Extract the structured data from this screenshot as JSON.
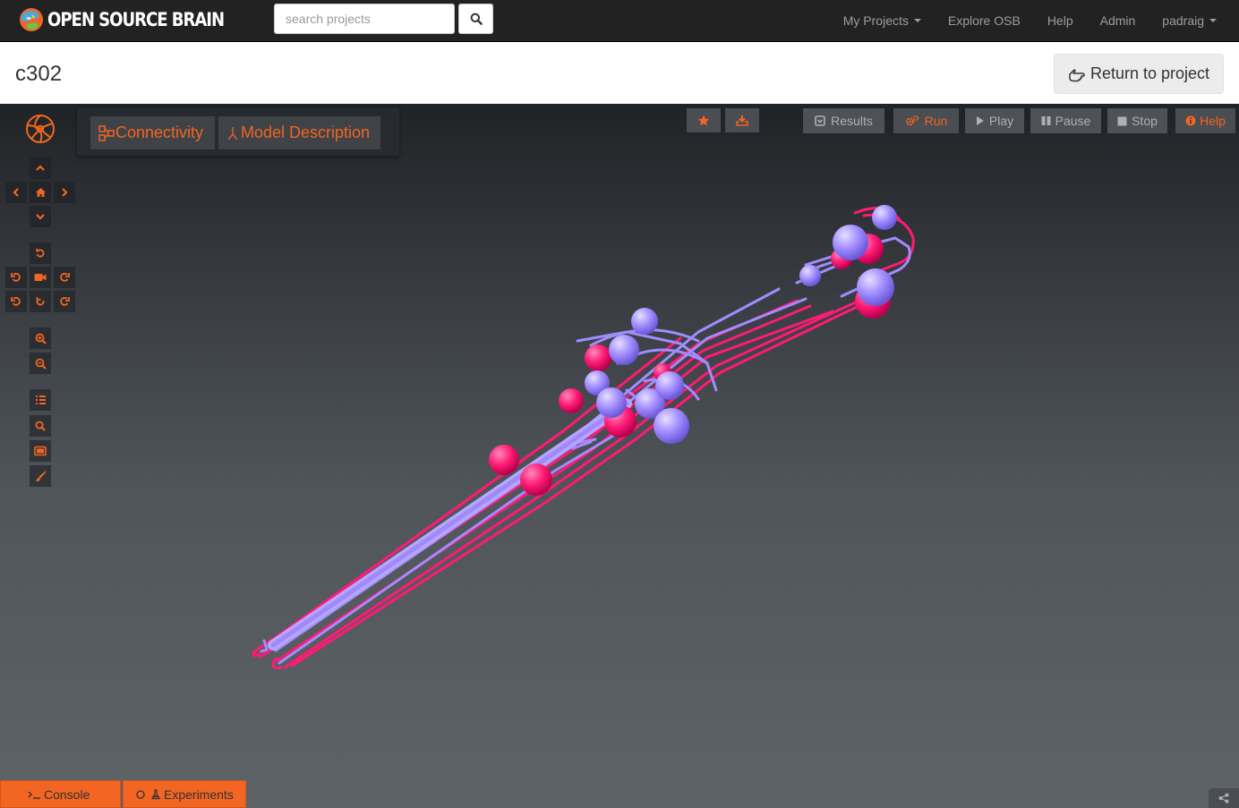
{
  "navbar": {
    "brand": "OPEN SOURCE BRAIN",
    "search_placeholder": "search projects",
    "links": [
      {
        "label": "My Projects",
        "dropdown": true
      },
      {
        "label": "Explore OSB",
        "dropdown": false
      },
      {
        "label": "Help",
        "dropdown": false
      },
      {
        "label": "Admin",
        "dropdown": false
      },
      {
        "label": "padraig",
        "dropdown": true
      }
    ]
  },
  "header": {
    "title": "c302",
    "return_label": "Return to project"
  },
  "viewer": {
    "tabs": {
      "connectivity": "Connectivity",
      "model_description": "Model Description"
    },
    "toolbar": {
      "results": "Results",
      "run": "Run",
      "play": "Play",
      "pause": "Pause",
      "stop": "Stop",
      "help": "Help"
    },
    "bottom": {
      "console": "Console",
      "experiments": "Experiments"
    },
    "colors": {
      "accent": "#f26522",
      "neuron_purple": "#a18cff",
      "neuron_pink": "#ff1a75"
    }
  }
}
